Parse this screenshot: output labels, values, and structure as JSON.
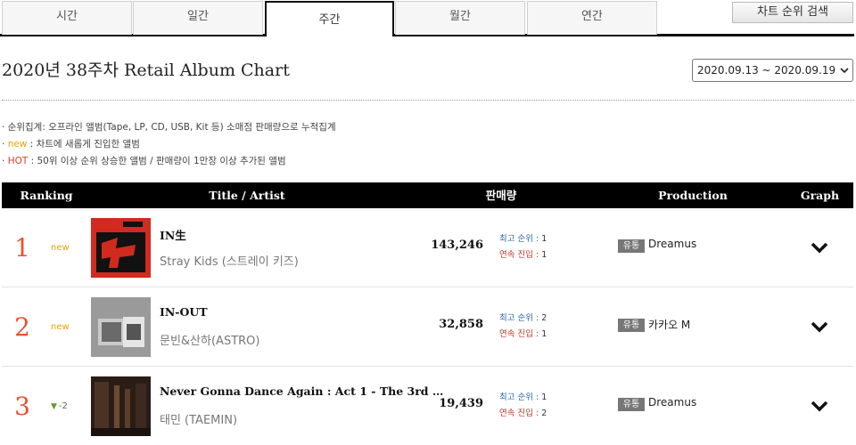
{
  "tabs": [
    {
      "label": "시간",
      "active": false
    },
    {
      "label": "일간",
      "active": false
    },
    {
      "label": "주간",
      "active": true
    },
    {
      "label": "월간",
      "active": false
    },
    {
      "label": "연간",
      "active": false
    }
  ],
  "search_button": "차트 순위 검색",
  "page_title": "2020년 38주차 Retail Album Chart",
  "date_range": "2020.09.13 ~ 2020.09.19",
  "notes": {
    "line1": "· 순위집계: 오프라인 앨범(Tape, LP, CD, USB, Kit 등) 소매점 판매량으로 누적집계",
    "line2_mark": "new",
    "line2_text": " : 차트에 새롭게 진입한 앨범",
    "line3_mark": "HOT",
    "line3_text": " : 50위 이상 순위 상승한 앨범 / 판매량이 1만장 이상 추가된 앨범"
  },
  "table_header": {
    "ranking": "Ranking",
    "title_artist": "Title / Artist",
    "sales": "판매량",
    "production": "Production",
    "graph": "Graph"
  },
  "labels": {
    "peak": "최고 순위 : ",
    "streak": "연속 진입 : ",
    "dist_badge": "유통"
  },
  "rows": [
    {
      "rank": "1",
      "change": "new",
      "title": "IN生",
      "artist": "Stray Kids (스트레이 키즈)",
      "sales": "143,246",
      "peak": "1",
      "streak": "1",
      "company": "Dreamus"
    },
    {
      "rank": "2",
      "change": "new",
      "title": "IN-OUT",
      "artist": "문빈&산하(ASTRO)",
      "sales": "32,858",
      "peak": "2",
      "streak": "1",
      "company": "카카오 M"
    },
    {
      "rank": "3",
      "change": "-2",
      "title": "Never Gonna Dance Again : Act 1 - The 3rd …",
      "artist": "태민 (TAEMIN)",
      "sales": "19,439",
      "peak": "1",
      "streak": "2",
      "company": "Dreamus"
    }
  ],
  "colors": {
    "rank": "#ea5030",
    "new": "#e8a300",
    "hot": "#e03c2a",
    "peak_label": "#2d6aa8",
    "streak_label": "#c0392b",
    "header_bg": "#000000"
  },
  "icons": {
    "graph_toggle": "chevron-down-icon",
    "date_select": "chevron-down-icon",
    "rank_down": "down-arrow-icon"
  }
}
